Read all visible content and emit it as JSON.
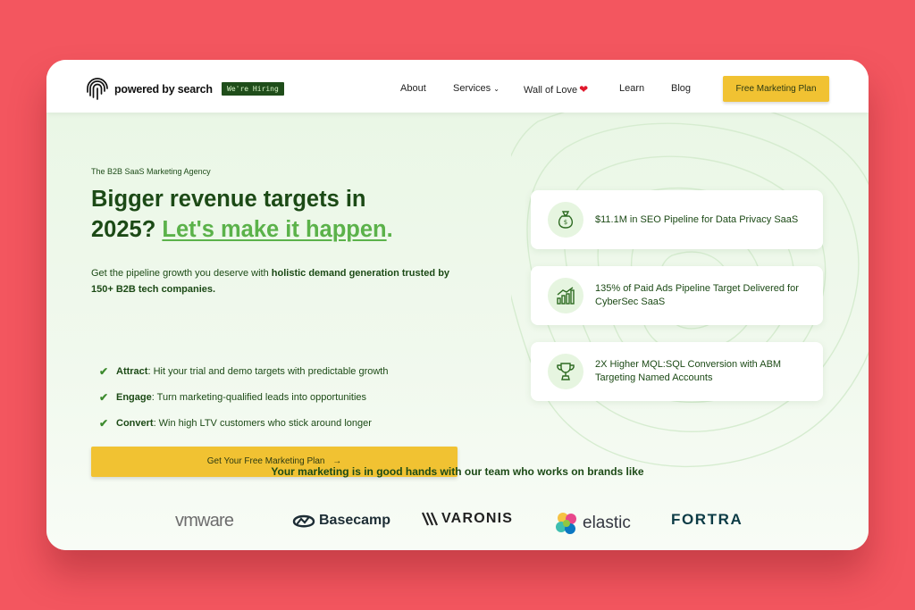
{
  "nav": {
    "logo_text": "powered by search",
    "hiring_badge": "We're Hiring",
    "links": [
      {
        "label": "About"
      },
      {
        "label": "Services"
      },
      {
        "label": "Wall of Love"
      },
      {
        "label": "Learn"
      },
      {
        "label": "Blog"
      }
    ],
    "cta": "Free Marketing Plan",
    "icons": {
      "services_dropdown": "chevron-down-icon",
      "wall_of_love": "heart-icon"
    }
  },
  "hero": {
    "eyebrow": "The B2B SaaS Marketing Agency",
    "headline_line1": "Bigger revenue targets in",
    "headline_year": "2025?",
    "headline_highlight": "Let's make it happen",
    "headline_end": ".",
    "intro_plain": "Get the pipeline growth you deserve with ",
    "intro_bold": "holistic demand generation trusted by 150+ B2B tech companies.",
    "bullets": [
      {
        "title": "Attract",
        "text": ": Hit your trial and demo targets with predictable growth"
      },
      {
        "title": "Engage",
        "text": ": Turn marketing-qualified leads into opportunities"
      },
      {
        "title": "Convert",
        "text": ": Win high LTV customers who stick around longer"
      }
    ],
    "cta": "Get Your Free Marketing Plan",
    "cta_arrow": "→"
  },
  "results": [
    {
      "icon": "money-bag-icon",
      "text": "$11.1M in SEO Pipeline for Data Privacy SaaS"
    },
    {
      "icon": "growth-chart-icon",
      "text": "135% of Paid Ads Pipeline Target Delivered for CyberSec SaaS"
    },
    {
      "icon": "trophy-icon",
      "text": "2X Higher MQL:SQL Conversion with ABM Targeting Named Accounts"
    }
  ],
  "trust": {
    "headline": "Your marketing is in good hands with our team who works on brands like",
    "brands": [
      "vmware",
      "Basecamp",
      "VARONIS",
      "elastic",
      "FORTRA"
    ]
  },
  "colors": {
    "background": "#f3565f",
    "brand_green": "#1c4a16",
    "accent_green": "#5bb24a",
    "cta_yellow": "#f1c232"
  }
}
